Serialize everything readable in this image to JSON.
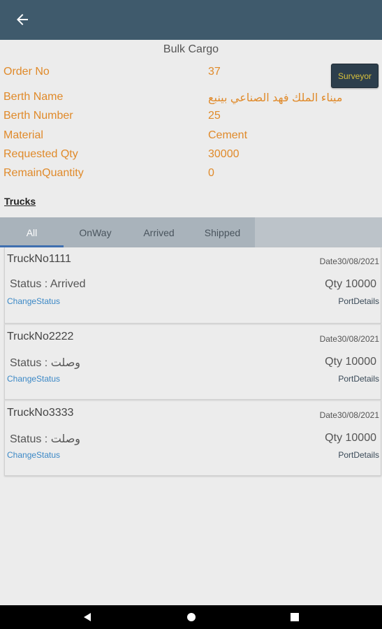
{
  "page": {
    "title": "Bulk Cargo"
  },
  "colors": {
    "appbar": "#3f5a6c",
    "label": "#e08a2a",
    "tab_indicator": "#3f6fb0",
    "link": "#3b88c6"
  },
  "info": [
    {
      "label": "Order No",
      "value": "37"
    },
    {
      "label": "Berth Name",
      "value": "ميناء الملك فهد الصناعي بينبع"
    },
    {
      "label": "Berth Number",
      "value": "25"
    },
    {
      "label": "Material",
      "value": "Cement"
    },
    {
      "label": "Requested Qty",
      "value": "30000"
    },
    {
      "label": "RemainQuantity",
      "value": "0"
    }
  ],
  "surveyor_label": "Surveyor",
  "trucks_title": "Trucks",
  "tabs": [
    {
      "label": "All",
      "active": true
    },
    {
      "label": "OnWay",
      "active": false
    },
    {
      "label": "Arrived",
      "active": false
    },
    {
      "label": "Shipped",
      "active": false
    }
  ],
  "trucks": [
    {
      "truck_no": "TruckNo1111",
      "date": "Date30/08/2021",
      "status": "Status : Arrived",
      "qty": "Qty 10000",
      "change_label": "ChangeStatus",
      "port_label": "PortDetails"
    },
    {
      "truck_no": "TruckNo2222",
      "date": "Date30/08/2021",
      "status": "Status : وصلت",
      "qty": "Qty 10000",
      "change_label": "ChangeStatus",
      "port_label": "PortDetails"
    },
    {
      "truck_no": "TruckNo3333",
      "date": "Date30/08/2021",
      "status": "Status : وصلت",
      "qty": "Qty 10000",
      "change_label": "ChangeStatus",
      "port_label": "PortDetails"
    }
  ],
  "icons": {
    "back": "arrow-left-icon",
    "nav_back": "triangle-back-icon",
    "nav_home": "circle-home-icon",
    "nav_recents": "square-recents-icon"
  }
}
